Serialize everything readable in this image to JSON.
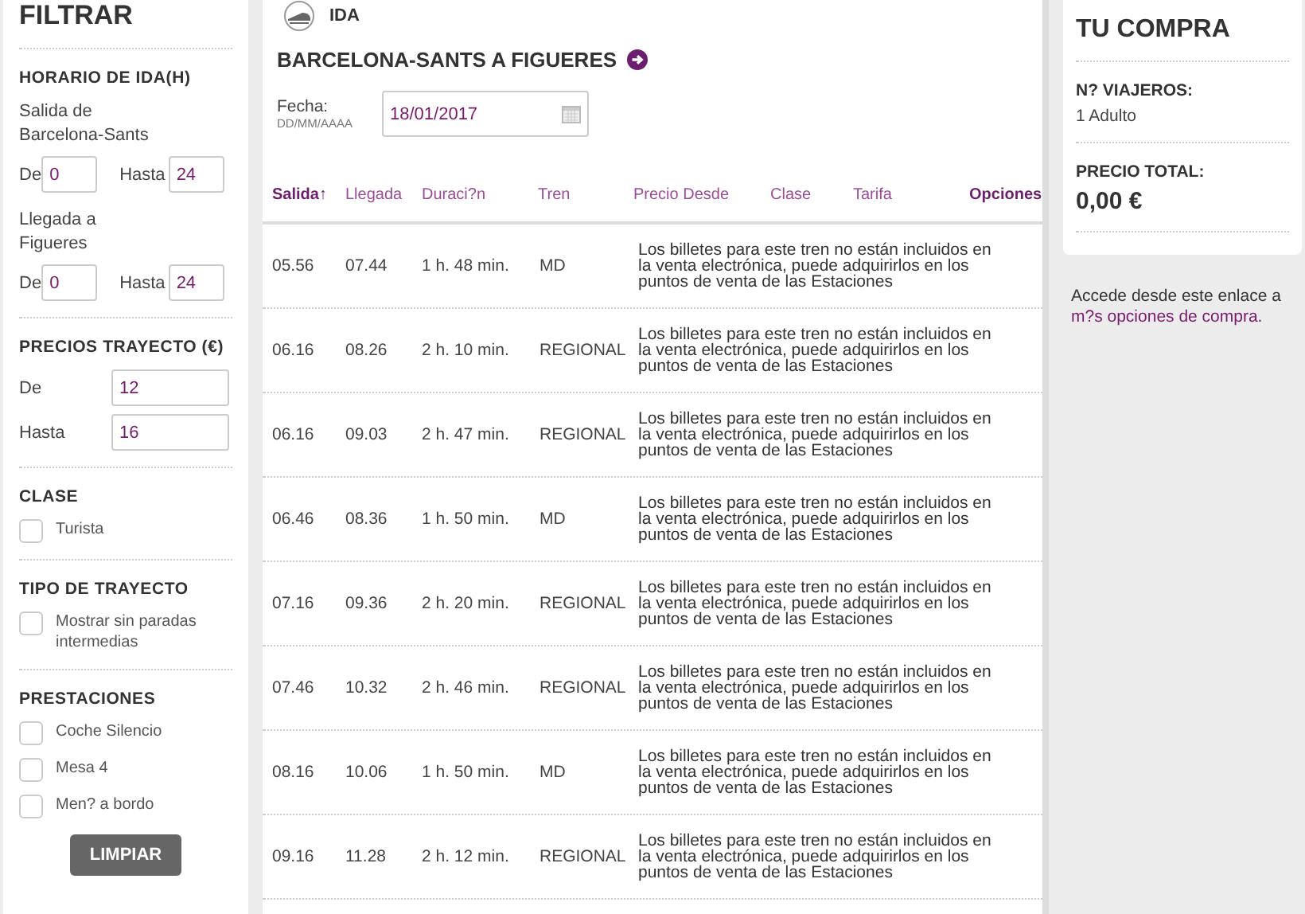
{
  "filters": {
    "title": "FILTRAR",
    "schedule": {
      "title": "HORARIO DE IDA(H)",
      "groups": [
        {
          "label": "Salida de Barcelona-Sants",
          "from_label": "De",
          "from": "0",
          "to_label": "Hasta",
          "to": "24"
        },
        {
          "label": "Llegada a Figueres",
          "from_label": "De",
          "from": "0",
          "to_label": "Hasta",
          "to": "24"
        }
      ]
    },
    "prices": {
      "title": "PRECIOS TRAYECTO (€)",
      "from_label": "De",
      "from": "12",
      "to_label": "Hasta",
      "to": "16"
    },
    "checkbox_sections": [
      {
        "title": "CLASE",
        "options": [
          {
            "label": "Turista",
            "checked": false
          }
        ]
      },
      {
        "title": "TIPO DE TRAYECTO",
        "options": [
          {
            "label": "Mostrar sin paradas intermedias",
            "checked": false
          }
        ]
      },
      {
        "title": "PRESTACIONES",
        "options": [
          {
            "label": "Coche Silencio",
            "checked": false
          },
          {
            "label": "Mesa 4",
            "checked": false
          },
          {
            "label": "Men? a bordo",
            "checked": false
          }
        ]
      }
    ],
    "clear_button": "LIMPIAR"
  },
  "journey": {
    "direction": "IDA",
    "route": "BARCELONA-SANTS A FIGUERES",
    "date_label": "Fecha:",
    "date_format": "DD/MM/AAAA",
    "date": "18/01/2017",
    "columns": [
      {
        "label": "Salida",
        "sort_mark": "↑",
        "selected": true,
        "kind": "sortable"
      },
      {
        "label": "Llegada",
        "selected": false,
        "kind": "sortable"
      },
      {
        "label": "Duraci?n",
        "selected": false,
        "kind": "sortable"
      },
      {
        "label": "Tren",
        "selected": false,
        "kind": "sortable"
      },
      {
        "label": "Precio Desde",
        "selected": false,
        "kind": "sortable"
      },
      {
        "label": "Clase",
        "selected": false,
        "kind": "sortable"
      },
      {
        "label": "Tarifa",
        "selected": false,
        "kind": "sortable"
      },
      {
        "label": "Opciones",
        "kind": "action"
      }
    ],
    "rows": [
      {
        "departure": "05.56",
        "arrival": "07.44",
        "duration": "1 h. 48 min.",
        "train": "MD",
        "note": "Los billetes para este tren no están incluidos en la venta electrónica, puede adquirirlos en los puntos de venta de las Estaciones"
      },
      {
        "departure": "06.16",
        "arrival": "08.26",
        "duration": "2 h. 10 min.",
        "train": "REGIONAL",
        "note": "Los billetes para este tren no están incluidos en la venta electrónica, puede adquirirlos en los puntos de venta de las Estaciones"
      },
      {
        "departure": "06.16",
        "arrival": "09.03",
        "duration": "2 h. 47 min.",
        "train": "REGIONAL",
        "note": "Los billetes para este tren no están incluidos en la venta electrónica, puede adquirirlos en los puntos de venta de las Estaciones"
      },
      {
        "departure": "06.46",
        "arrival": "08.36",
        "duration": "1 h. 50 min.",
        "train": "MD",
        "note": "Los billetes para este tren no están incluidos en la venta electrónica, puede adquirirlos en los puntos de venta de las Estaciones"
      },
      {
        "departure": "07.16",
        "arrival": "09.36",
        "duration": "2 h. 20 min.",
        "train": "REGIONAL",
        "note": "Los billetes para este tren no están incluidos en la venta electrónica, puede adquirirlos en los puntos de venta de las Estaciones"
      },
      {
        "departure": "07.46",
        "arrival": "10.32",
        "duration": "2 h. 46 min.",
        "train": "REGIONAL",
        "note": "Los billetes para este tren no están incluidos en la venta electrónica, puede adquirirlos en los puntos de venta de las Estaciones"
      },
      {
        "departure": "08.16",
        "arrival": "10.06",
        "duration": "1 h. 50 min.",
        "train": "MD",
        "note": "Los billetes para este tren no están incluidos en la venta electrónica, puede adquirirlos en los puntos de venta de las Estaciones"
      },
      {
        "departure": "09.16",
        "arrival": "11.28",
        "duration": "2 h. 12 min.",
        "train": "REGIONAL",
        "note": "Los billetes para este tren no están incluidos en la venta electrónica, puede adquirirlos en los puntos de venta de las Estaciones"
      }
    ]
  },
  "purchase": {
    "title": "TU COMPRA",
    "travelers_label": "N? VIAJEROS:",
    "travelers": "1 Adulto",
    "total_label": "PRECIO TOTAL:",
    "total": "0,00 €",
    "more_text": "Accede desde este enlace a",
    "more_link": "m?s opciones de compra."
  }
}
